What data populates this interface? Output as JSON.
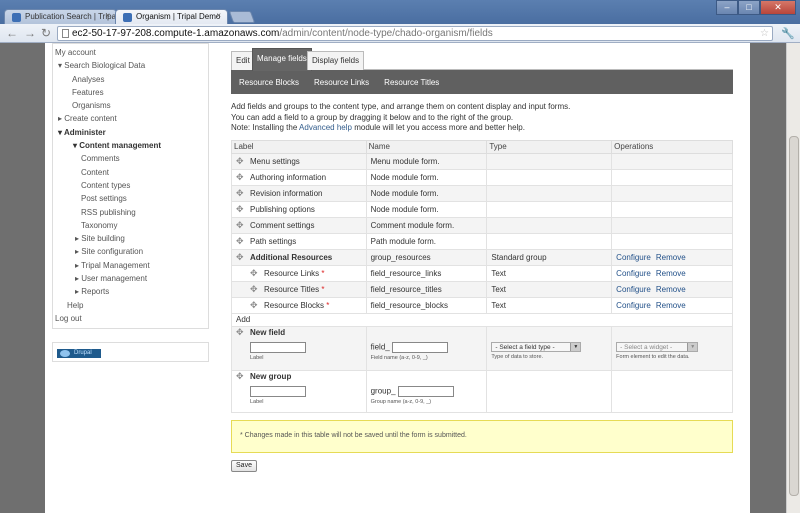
{
  "browser": {
    "tabs": [
      {
        "title": "Publication Search | Tripa"
      },
      {
        "title": "Organism | Tripal Demo"
      }
    ],
    "url_host": "ec2-50-17-97-208.compute-1.amazonaws.com",
    "url_path": "/admin/content/node-type/chado-organism/fields",
    "window_controls": {
      "minimize": "–",
      "maximize": "□",
      "close": "✕"
    }
  },
  "sidebar": {
    "items": [
      {
        "label": "My account"
      },
      {
        "label": "▾ Search Biological Data"
      },
      {
        "label": "Analyses"
      },
      {
        "label": "Features"
      },
      {
        "label": "Organisms"
      },
      {
        "label": "▸ Create content"
      },
      {
        "label": "▾ Administer"
      },
      {
        "label": "▾ Content management"
      },
      {
        "label": "Comments"
      },
      {
        "label": "Content"
      },
      {
        "label": "Content types"
      },
      {
        "label": "Post settings"
      },
      {
        "label": "RSS publishing"
      },
      {
        "label": "Taxonomy"
      },
      {
        "label": "▸ Site building"
      },
      {
        "label": "▸ Site configuration"
      },
      {
        "label": "▸ Tripal Management"
      },
      {
        "label": "▸ User management"
      },
      {
        "label": "▸ Reports"
      },
      {
        "label": "Help"
      },
      {
        "label": "Log out"
      }
    ],
    "drupal_badge": "Drupal"
  },
  "tabs": {
    "edit": "Edit",
    "manage": "Manage fields",
    "display": "Display fields"
  },
  "subtabs": {
    "blocks": "Resource Blocks",
    "links": "Resource Links",
    "titles": "Resource Titles"
  },
  "help": {
    "line1": "Add fields and groups to the content type, and arrange them on content display and input forms.",
    "line2": "You can add a field to a group by dragging it below and to the right of the group.",
    "line3_pre": "Note: Installing the ",
    "line3_link": "Advanced help",
    "line3_post": " module will let you access more and better help."
  },
  "table": {
    "headers": [
      "Label",
      "Name",
      "Type",
      "Operations"
    ],
    "rows": [
      {
        "label": "Menu settings",
        "name": "Menu module form.",
        "type": "",
        "req": ""
      },
      {
        "label": "Authoring information",
        "name": "Node module form.",
        "type": "",
        "req": ""
      },
      {
        "label": "Revision information",
        "name": "Node module form.",
        "type": "",
        "req": ""
      },
      {
        "label": "Publishing options",
        "name": "Node module form.",
        "type": "",
        "req": ""
      },
      {
        "label": "Comment settings",
        "name": "Comment module form.",
        "type": "",
        "req": ""
      },
      {
        "label": "Path settings",
        "name": "Path module form.",
        "type": "",
        "req": ""
      },
      {
        "label": "Additional Resources",
        "name": "group_resources",
        "type": "Standard group",
        "req": "",
        "op1": "Configure",
        "op2": "Remove"
      },
      {
        "label": "Resource Links",
        "name": "field_resource_links",
        "type": "Text",
        "req": "*",
        "op1": "Configure",
        "op2": "Remove"
      },
      {
        "label": "Resource Titles",
        "name": "field_resource_titles",
        "type": "Text",
        "req": "*",
        "op1": "Configure",
        "op2": "Remove"
      },
      {
        "label": "Resource Blocks",
        "name": "field_resource_blocks",
        "type": "Text",
        "req": "*",
        "op1": "Configure",
        "op2": "Remove"
      }
    ],
    "add_label": "Add",
    "new_field": {
      "title": "New field",
      "label_desc": "Label",
      "name_prefix": "field_",
      "name_desc": "Field name (a-z, 0-9, _)",
      "type_select": "- Select a field type -",
      "type_desc": "Type of data to store.",
      "widget_select": "- Select a widget -",
      "widget_desc": "Form element to edit the data."
    },
    "new_group": {
      "title": "New group",
      "label_desc": "Label",
      "name_prefix": "group_",
      "name_desc": "Group name (a-z, 0-9, _)"
    }
  },
  "warning": "* Changes made in this table will not be saved until the form is submitted.",
  "save_label": "Save"
}
